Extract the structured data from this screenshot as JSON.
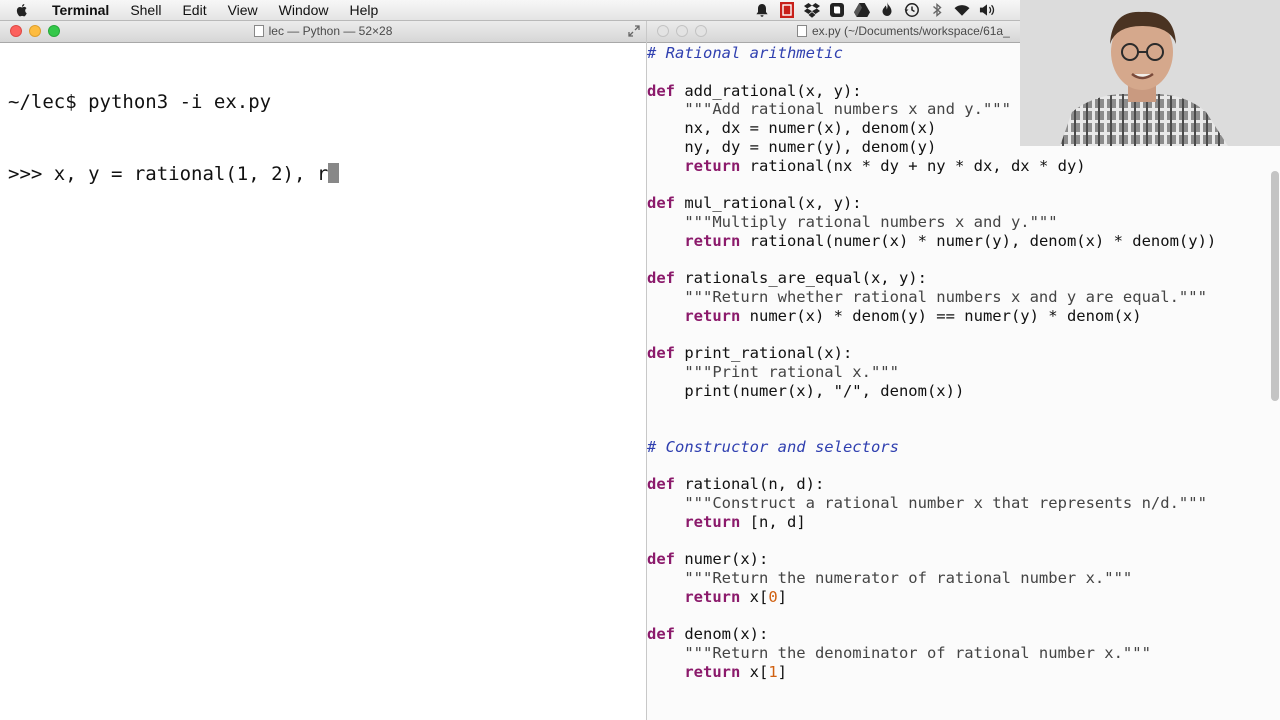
{
  "menubar": {
    "apple_icon": "apple-icon",
    "app_name": "Terminal",
    "items": [
      "Shell",
      "Edit",
      "View",
      "Window",
      "Help"
    ],
    "tray_icons": [
      "bell-icon",
      "red-square-icon",
      "dropbox-icon",
      "evernote-icon",
      "drive-icon",
      "flame-icon",
      "time-machine-icon",
      "bluetooth-icon",
      "wifi-icon",
      "volume-icon"
    ]
  },
  "terminal": {
    "title": "lec — Python — 52×28",
    "lines": [
      "~/lec$ python3 -i ex.py",
      ">>> x, y = rational(1, 2), r"
    ]
  },
  "editor": {
    "title": "ex.py (~/Documents/workspace/61a_"
  },
  "colors": {
    "comment": "#3040b0",
    "keyword": "#8b1a6b",
    "number": "#d06010"
  },
  "code_lines": [
    [
      {
        "t": "# Rational arithmetic",
        "c": "cmt"
      }
    ],
    [
      {
        "t": ""
      }
    ],
    [
      {
        "t": "def",
        "c": "kw"
      },
      {
        "t": " add_rational(x, y):"
      }
    ],
    [
      {
        "t": "    \"\"\"Add rational numbers x and y.\"\"\"",
        "c": "str"
      }
    ],
    [
      {
        "t": "    nx, dx = numer(x), denom(x)"
      }
    ],
    [
      {
        "t": "    ny, dy = numer(y), denom(y)"
      }
    ],
    [
      {
        "t": "    "
      },
      {
        "t": "return",
        "c": "kw"
      },
      {
        "t": " rational(nx * dy + ny * dx, dx * dy)"
      }
    ],
    [
      {
        "t": ""
      }
    ],
    [
      {
        "t": "def",
        "c": "kw"
      },
      {
        "t": " mul_rational(x, y):"
      }
    ],
    [
      {
        "t": "    \"\"\"Multiply rational numbers x and y.\"\"\"",
        "c": "str"
      }
    ],
    [
      {
        "t": "    "
      },
      {
        "t": "return",
        "c": "kw"
      },
      {
        "t": " rational(numer(x) * numer(y), denom(x) * denom(y))"
      }
    ],
    [
      {
        "t": ""
      }
    ],
    [
      {
        "t": "def",
        "c": "kw"
      },
      {
        "t": " rationals_are_equal(x, y):"
      }
    ],
    [
      {
        "t": "    \"\"\"Return whether rational numbers x and y are equal.\"\"\"",
        "c": "str"
      }
    ],
    [
      {
        "t": "    "
      },
      {
        "t": "return",
        "c": "kw"
      },
      {
        "t": " numer(x) * denom(y) == numer(y) * denom(x)"
      }
    ],
    [
      {
        "t": ""
      }
    ],
    [
      {
        "t": "def",
        "c": "kw"
      },
      {
        "t": " print_rational(x):"
      }
    ],
    [
      {
        "t": "    \"\"\"Print rational x.\"\"\"",
        "c": "str"
      }
    ],
    [
      {
        "t": "    print(numer(x), \"/\", denom(x))"
      }
    ],
    [
      {
        "t": ""
      }
    ],
    [
      {
        "t": ""
      }
    ],
    [
      {
        "t": "# Constructor and selectors",
        "c": "cmt"
      }
    ],
    [
      {
        "t": ""
      }
    ],
    [
      {
        "t": "def",
        "c": "kw"
      },
      {
        "t": " rational(n, d):"
      }
    ],
    [
      {
        "t": "    \"\"\"Construct a rational number x that represents n/d.\"\"\"",
        "c": "str"
      }
    ],
    [
      {
        "t": "    "
      },
      {
        "t": "return",
        "c": "kw"
      },
      {
        "t": " [n, d]"
      }
    ],
    [
      {
        "t": ""
      }
    ],
    [
      {
        "t": "def",
        "c": "kw"
      },
      {
        "t": " numer(x):"
      }
    ],
    [
      {
        "t": "    \"\"\"Return the numerator of rational number x.\"\"\"",
        "c": "str"
      }
    ],
    [
      {
        "t": "    "
      },
      {
        "t": "return",
        "c": "kw"
      },
      {
        "t": " x["
      },
      {
        "t": "0",
        "c": "num"
      },
      {
        "t": "]"
      }
    ],
    [
      {
        "t": ""
      }
    ],
    [
      {
        "t": "def",
        "c": "kw"
      },
      {
        "t": " denom(x):"
      }
    ],
    [
      {
        "t": "    \"\"\"Return the denominator of rational number x.\"\"\"",
        "c": "str"
      }
    ],
    [
      {
        "t": "    "
      },
      {
        "t": "return",
        "c": "kw"
      },
      {
        "t": " x["
      },
      {
        "t": "1",
        "c": "num"
      },
      {
        "t": "]"
      }
    ]
  ]
}
